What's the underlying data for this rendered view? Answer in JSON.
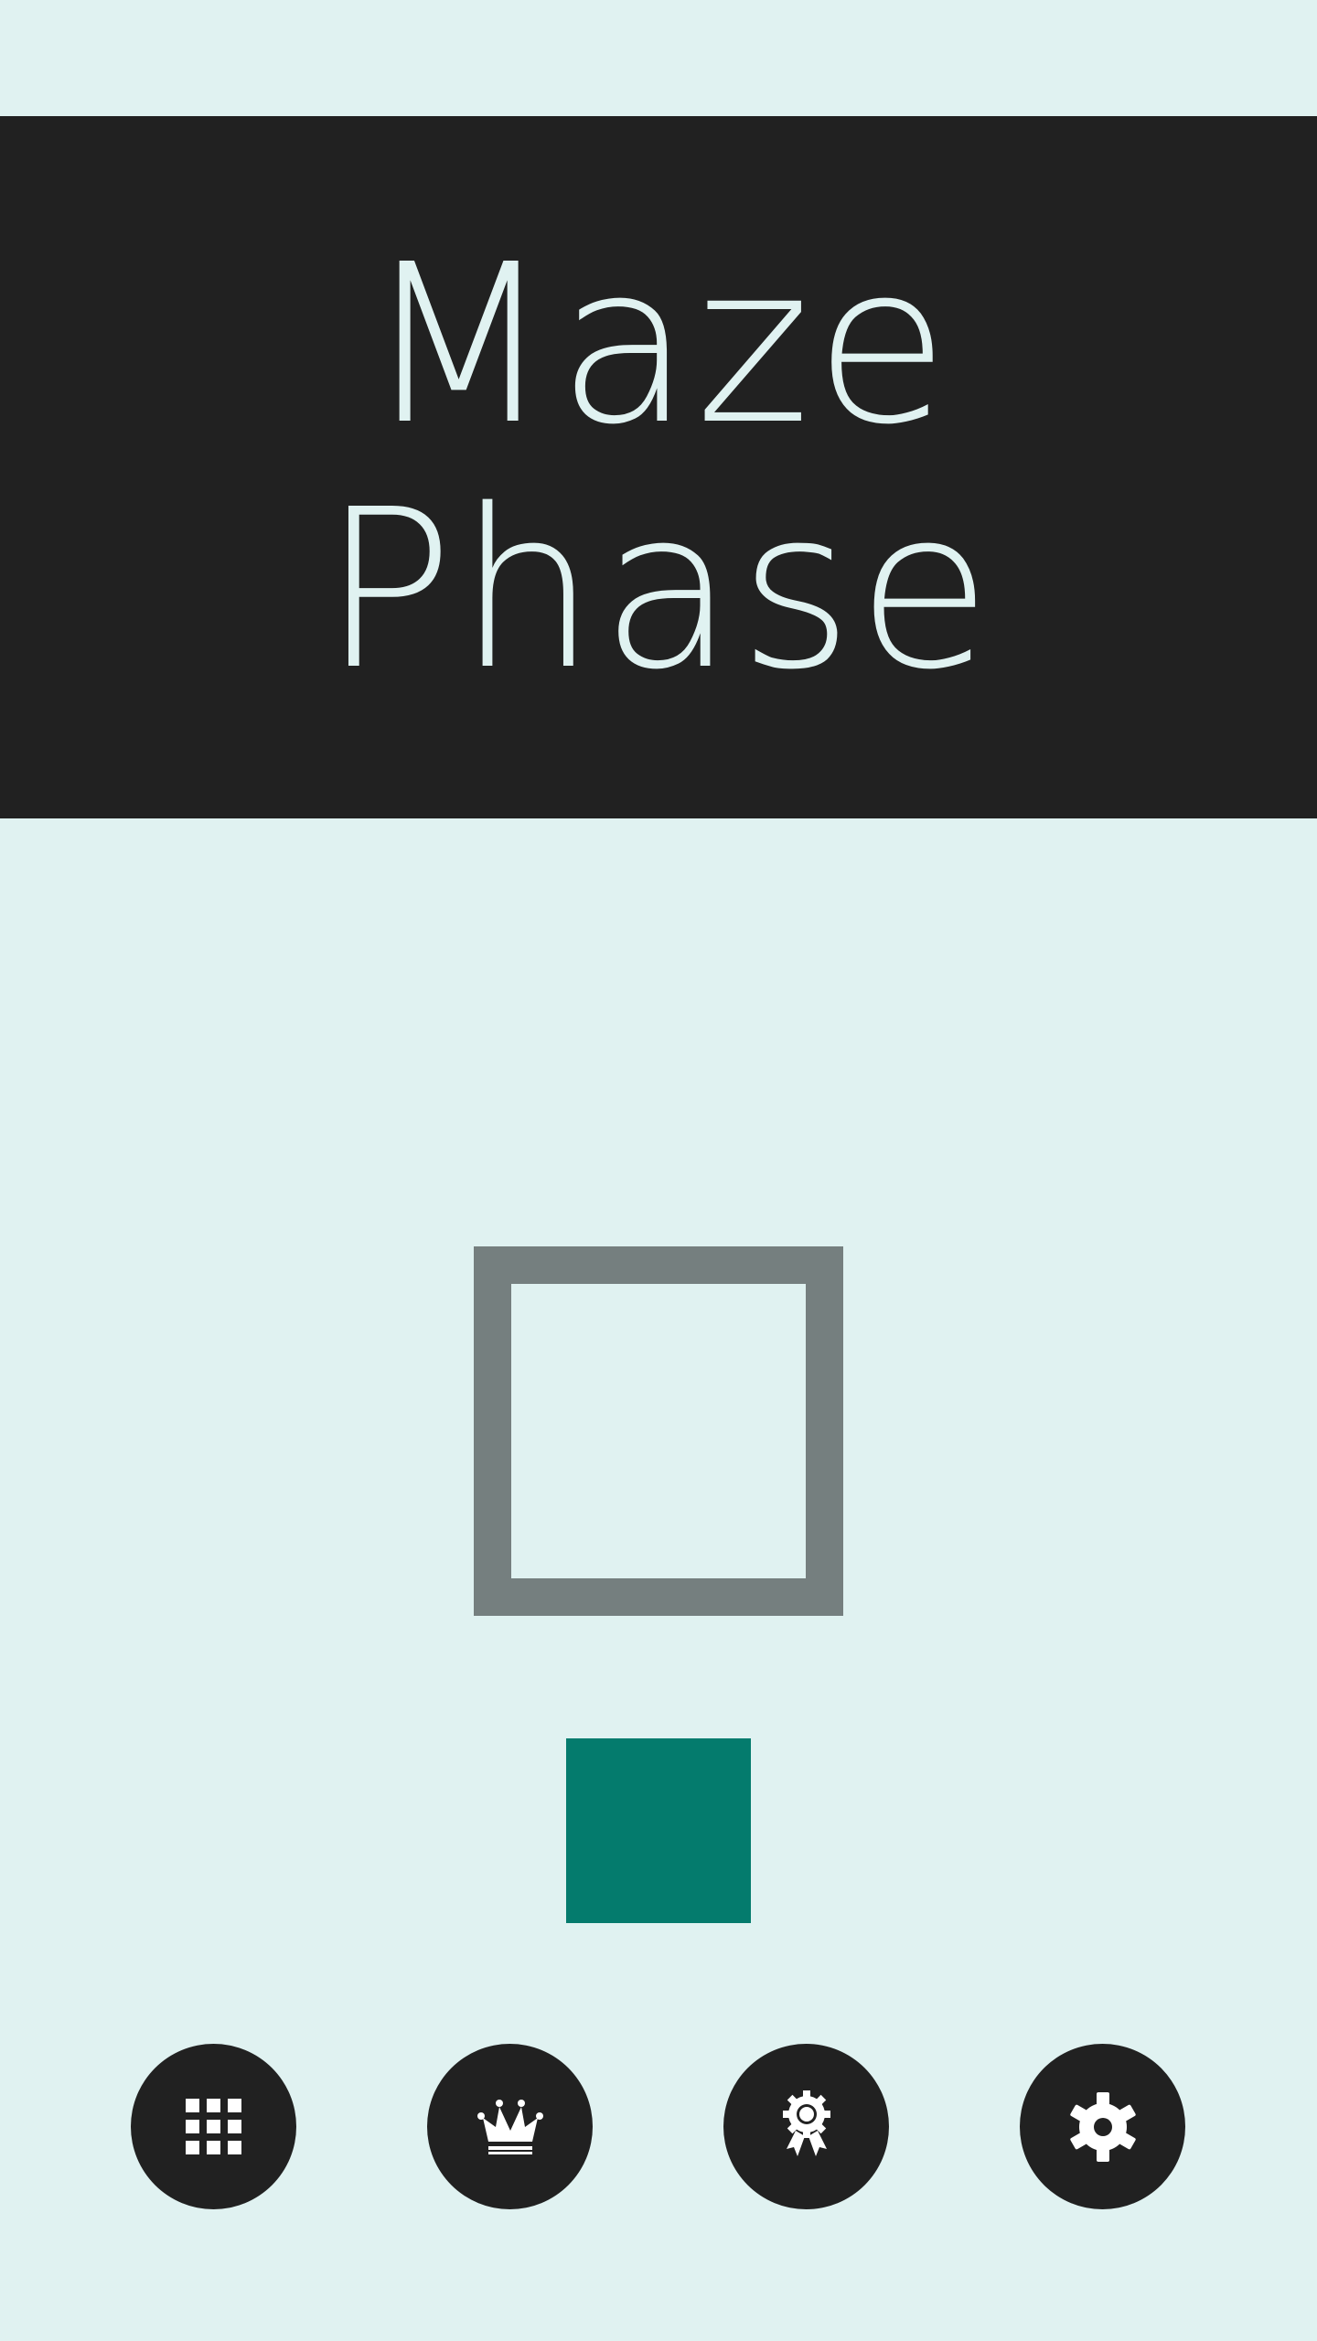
{
  "app": {
    "title_line1": "Maze",
    "title_line2": "Phase"
  },
  "colors": {
    "background": "#e0f2f1",
    "banner": "#212121",
    "title_text": "#e0f2f1",
    "maze_frame": "#757f7f",
    "player": "#047b6d",
    "button": "#212121",
    "icon": "#ffffff"
  },
  "menu": [
    {
      "icon": "grid-icon",
      "action": "levels"
    },
    {
      "icon": "crown-icon",
      "action": "leaderboard"
    },
    {
      "icon": "award-icon",
      "action": "achievements"
    },
    {
      "icon": "gear-icon",
      "action": "settings"
    }
  ]
}
